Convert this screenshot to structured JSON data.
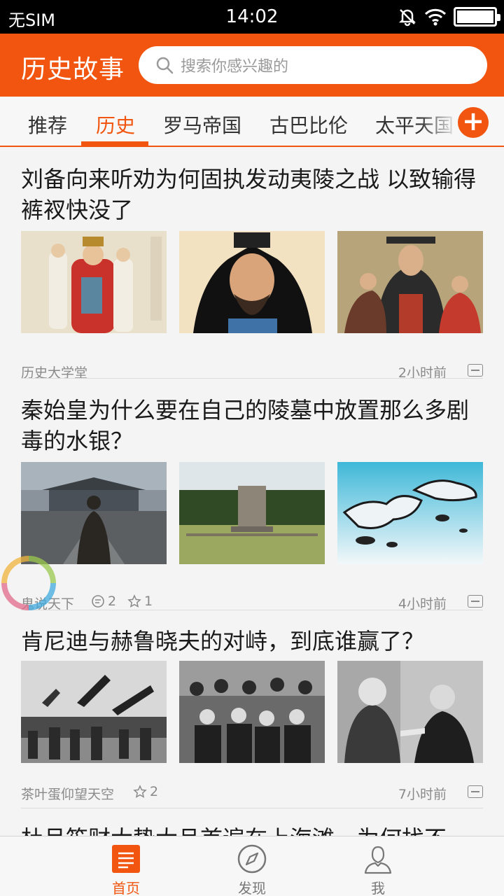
{
  "status_bar": {
    "carrier": "无SIM",
    "time": "14:02",
    "icons": [
      "mute-bell-icon",
      "wifi-icon",
      "battery-icon"
    ]
  },
  "header": {
    "title": "历史故事",
    "search_placeholder": "搜索你感兴趣的"
  },
  "tabs": {
    "items": [
      "推荐",
      "历史",
      "罗马帝国",
      "古巴比伦",
      "太平天国"
    ],
    "active": "历史",
    "add_icon": "plus-icon"
  },
  "articles": [
    {
      "title": "刘备向来听劝为何固执发动夷陵之战 以致输得裤衩快没了",
      "source": "历史大学堂",
      "time": "2小时前"
    },
    {
      "title": "秦始皇为什么要在自己的陵墓中放置那么多剧毒的水银？",
      "source": "鬼说天下",
      "comments": "2",
      "stars": "1",
      "time": "4小时前"
    },
    {
      "title": "肯尼迪与赫鲁晓夫的对峙，到底谁赢了？",
      "source": "茶叶蛋仰望天空",
      "stars": "2",
      "time": "7小时前"
    },
    {
      "title": "杜月笙财大势大且首遍在上海滩，为何找不"
    }
  ],
  "bottom_nav": {
    "items": [
      {
        "label": "首页",
        "icon": "home-list-icon"
      },
      {
        "label": "发现",
        "icon": "compass-icon"
      },
      {
        "label": "我",
        "icon": "profile-icon"
      }
    ],
    "active": "首页"
  },
  "colors": {
    "accent": "#f1550f",
    "background": "#f4f4f4",
    "meta_text": "#8a8a8a"
  }
}
